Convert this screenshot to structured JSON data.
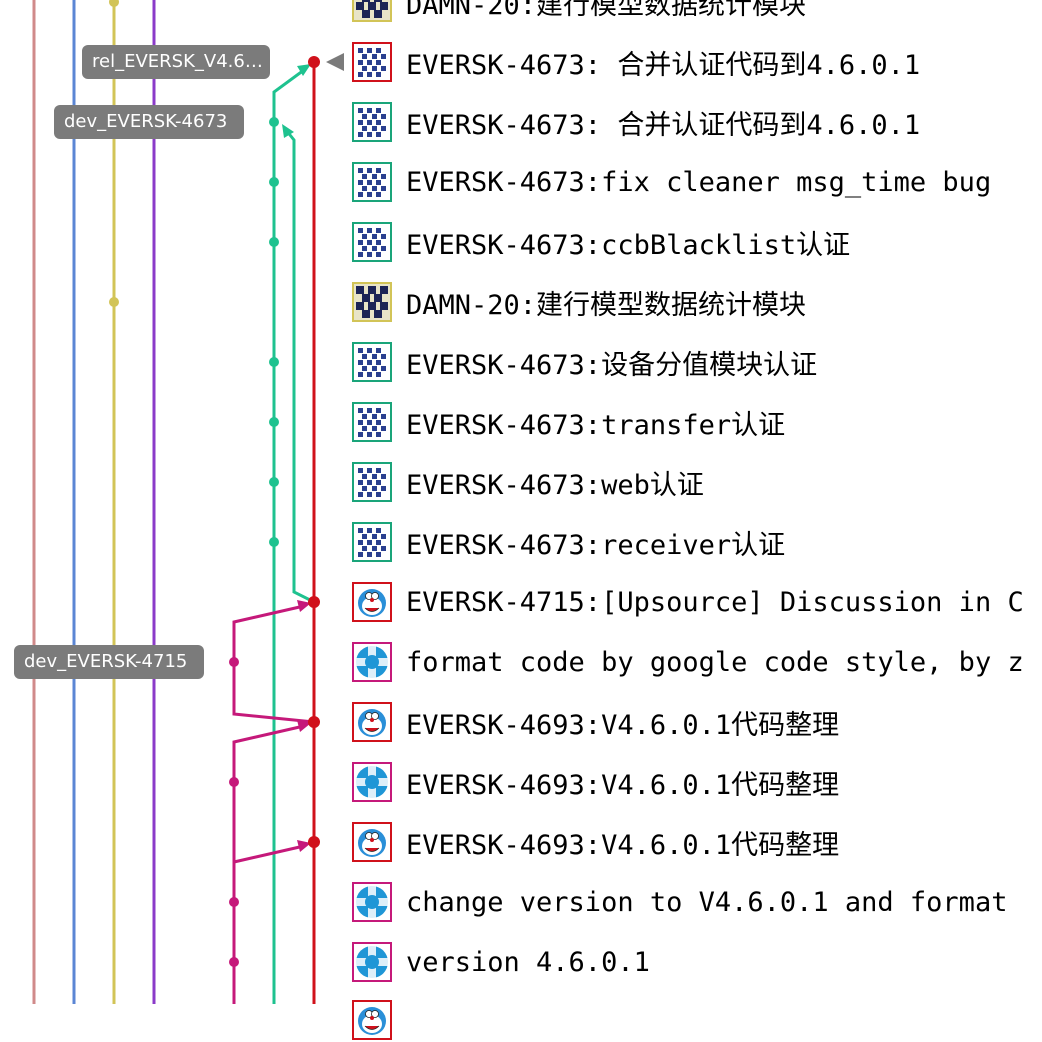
{
  "colors": {
    "lane_pink": "#d08a8a",
    "lane_blue": "#5b86d4",
    "lane_yellow": "#d2c457",
    "lane_purple": "#8b3bc9",
    "lane_teal": "#1ec28f",
    "lane_red": "#d0111b",
    "lane_magenta": "#c5197a",
    "tag_bg": "#7b7b7b"
  },
  "tags": [
    {
      "label": "rel_EVERSK_V4.6…"
    },
    {
      "label": "dev_EVERSK-4673"
    },
    {
      "label": "dev_EVERSK-4715"
    }
  ],
  "commits": [
    {
      "message": "DAMN-20:建行模型数据统计模块",
      "avatar": "navy-pattern-avatar"
    },
    {
      "message": "EVERSK-4673: 合并认证代码到4.6.0.1",
      "avatar": "blue-pattern-avatar"
    },
    {
      "message": "EVERSK-4673: 合并认证代码到4.6.0.1",
      "avatar": "blue-pattern-avatar"
    },
    {
      "message": "EVERSK-4673:fix cleaner msg_time bug",
      "avatar": "blue-pattern-avatar"
    },
    {
      "message": "EVERSK-4673:ccbBlacklist认证",
      "avatar": "blue-pattern-avatar"
    },
    {
      "message": "DAMN-20:建行模型数据统计模块",
      "avatar": "navy-pattern-avatar"
    },
    {
      "message": "EVERSK-4673:设备分值模块认证",
      "avatar": "blue-pattern-avatar"
    },
    {
      "message": "EVERSK-4673:transfer认证",
      "avatar": "blue-pattern-avatar"
    },
    {
      "message": "EVERSK-4673:web认证",
      "avatar": "blue-pattern-avatar"
    },
    {
      "message": "EVERSK-4673:receiver认证",
      "avatar": "blue-pattern-avatar"
    },
    {
      "message": "EVERSK-4715:[Upsource] Discussion in C",
      "avatar": "doraemon-avatar"
    },
    {
      "message": "format code by google code style, by z",
      "avatar": "cyan-circle-avatar"
    },
    {
      "message": "EVERSK-4693:V4.6.0.1代码整理",
      "avatar": "doraemon-avatar"
    },
    {
      "message": "EVERSK-4693:V4.6.0.1代码整理",
      "avatar": "cyan-circle-avatar"
    },
    {
      "message": "EVERSK-4693:V4.6.0.1代码整理",
      "avatar": "doraemon-avatar"
    },
    {
      "message": "change version to V4.6.0.1 and format",
      "avatar": "cyan-circle-avatar"
    },
    {
      "message": "version 4.6.0.1",
      "avatar": "cyan-circle-avatar"
    },
    {
      "message": "",
      "avatar": "doraemon-avatar"
    }
  ]
}
